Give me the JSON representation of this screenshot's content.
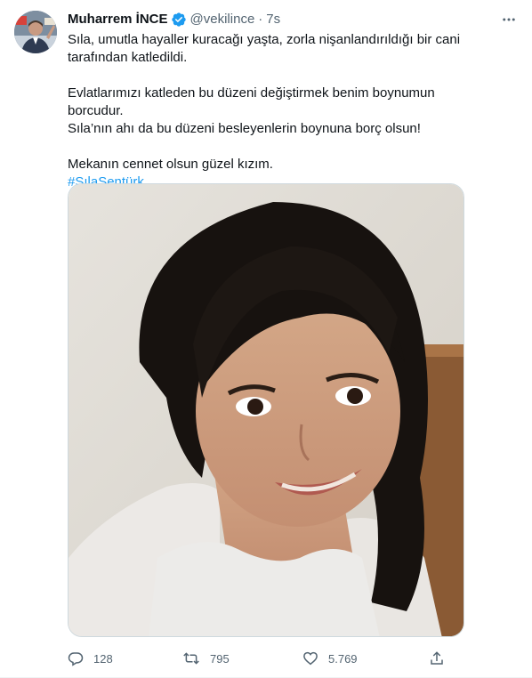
{
  "tweet": {
    "author": {
      "display_name": "Muharrem İNCE",
      "handle": "@vekilince",
      "separator": "·",
      "time": "7s",
      "verified": true,
      "avatar_icon": "user-avatar"
    },
    "text": {
      "paragraph1": "Sıla, umutla hayaller kuracağı yaşta, zorla nişanlandırıldığı bir cani tarafından katledildi.",
      "paragraph2": "Evlatlarımızı katleden bu düzeni değiştirmek benim boynumun borcudur.\nSıla’nın ahı da bu düzeni besleyenlerin boynuna borç olsun!",
      "paragraph3": "Mekanın cennet olsun güzel kızım.",
      "hashtag": "#SılaŞentürk"
    },
    "media": {
      "type": "photo",
      "icon": "photo-of-girl"
    },
    "actions": {
      "replies": "128",
      "retweets": "795",
      "likes": "5.769",
      "reply_icon": "reply-icon",
      "retweet_icon": "retweet-icon",
      "like_icon": "like-icon",
      "share_icon": "share-icon"
    }
  },
  "colors": {
    "accent": "#1d9bf0",
    "secondary_text": "#536471",
    "primary_text": "#0f1419",
    "border": "#cfd9de"
  }
}
